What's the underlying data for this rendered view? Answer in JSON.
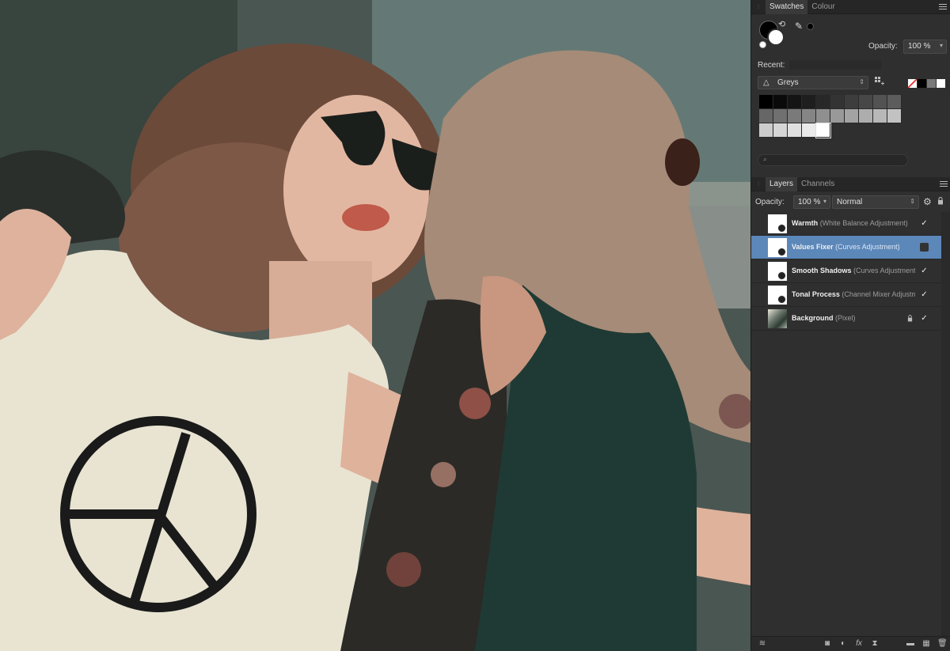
{
  "swatches_panel": {
    "tabs": [
      "Swatches",
      "Colour"
    ],
    "opacity_label": "Opacity:",
    "opacity_value": "100 %",
    "recent_label": "Recent:",
    "palette_name": "Greys",
    "grey_swatches": [
      "#000000",
      "#0a0a0a",
      "#141414",
      "#1e1e1e",
      "#282828",
      "#333333",
      "#3d3d3d",
      "#474747",
      "#525252",
      "#5c5c5c",
      "#666666",
      "#707070",
      "#7a7a7a",
      "#858585",
      "#8f8f8f",
      "#999999",
      "#a3a3a3",
      "#adadad",
      "#b8b8b8",
      "#c2c2c2",
      "#cccccc",
      "#d6d6d6",
      "#e0e0e0",
      "#eaeaea",
      "#ffffff"
    ],
    "mini_swatches": [
      "#ffffff",
      "#000000",
      "#7a7a7a",
      "#ffffff"
    ]
  },
  "layers_panel": {
    "tabs": [
      "Layers",
      "Channels"
    ],
    "opacity_label": "Opacity:",
    "opacity_value": "100 %",
    "blend_mode": "Normal",
    "layers": [
      {
        "name": "Warmth",
        "type": "(White Balance Adjustment)",
        "visible": true,
        "selected": false,
        "locked": false
      },
      {
        "name": "Values Fixer",
        "type": "(Curves Adjustment)",
        "visible": false,
        "selected": true,
        "locked": false
      },
      {
        "name": "Smooth Shadows",
        "type": "(Curves Adjustment)",
        "visible": true,
        "selected": false,
        "locked": false
      },
      {
        "name": "Tonal Process",
        "type": "(Channel Mixer Adjustment)",
        "visible": true,
        "selected": false,
        "locked": false
      },
      {
        "name": "Background",
        "type": "(Pixel)",
        "visible": true,
        "selected": false,
        "locked": true
      }
    ]
  },
  "icons": {
    "menu": "menu-icon",
    "eyedropper": "eyedropper-icon",
    "swap": "swap-colors-icon",
    "palette_triangle": "palette-triangle-icon",
    "grid": "swatch-grid-icon",
    "search": "search-icon",
    "gear": "gear-icon",
    "lock": "lock-icon"
  },
  "colors": {
    "panel_bg": "#2f2f2f",
    "selected_row": "#5c87b9"
  }
}
